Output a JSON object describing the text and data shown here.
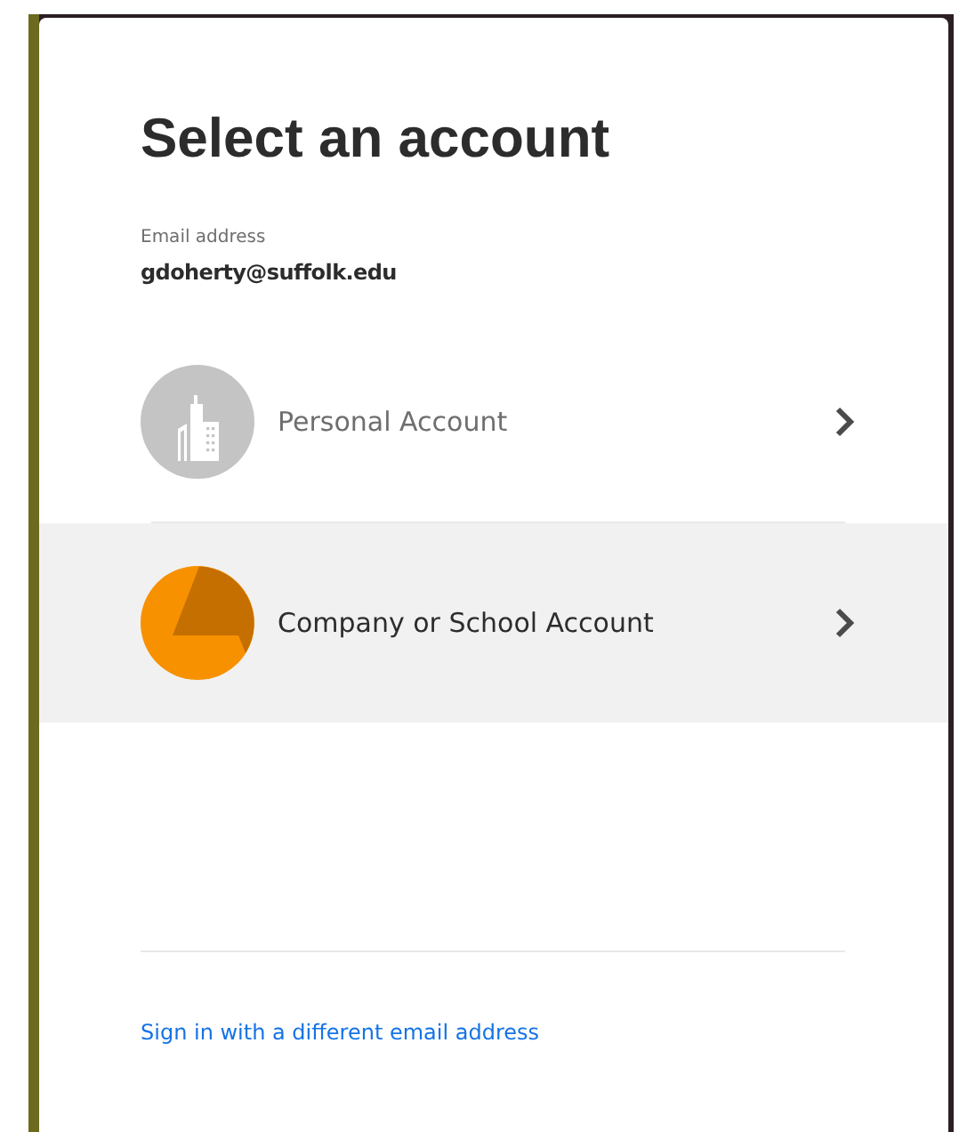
{
  "title": "Select an account",
  "email": {
    "label": "Email address",
    "value": "gdoherty@suffolk.edu"
  },
  "accounts": [
    {
      "kind": "personal",
      "label": "Personal Account",
      "selected": false
    },
    {
      "kind": "company",
      "label": "Company or School Account",
      "selected": true
    }
  ],
  "footer_link": "Sign in with a different email address"
}
